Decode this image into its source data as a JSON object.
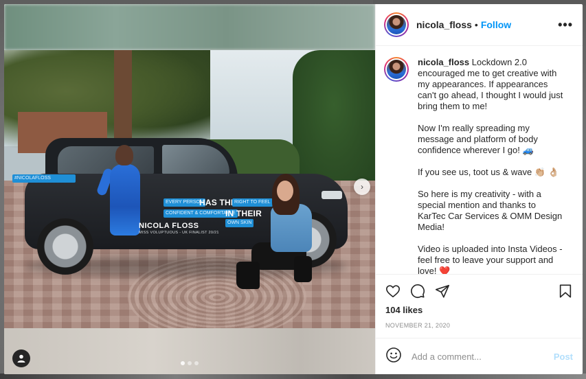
{
  "post": {
    "username": "nicola_floss",
    "separator": "•",
    "follow_label": "Follow",
    "more_label": "•••",
    "caption_paragraphs": [
      "Lockdown 2.0 encouraged me to get creative with my appearances. If appearances can't go ahead, I thought I would just bring them to me!",
      "Now I'm really spreading my message and platform of body confidence wherever I go! 🚙",
      "If you see us, toot us & wave 👏🏼 👌🏼",
      "So here is my creativity - with a special mention and thanks to KarTec Car Services & OMM Design Media!",
      "Video is uploaded into Insta Videos - feel free to leave your support and love! ❤️"
    ],
    "likes": "104 likes",
    "date": "NOVEMBER 21, 2020",
    "comment_placeholder": "Add a comment...",
    "post_label": "Post"
  },
  "media": {
    "car_wrap": {
      "banner": "#NICOLAFLOSS",
      "pill_every": "EVERY PERSON",
      "headline_1": "HAS THE",
      "pill_right": "RIGHT TO FEEL",
      "pill_confident": "CONFIDENT & COMFORTABLE",
      "headline_2": "IN THEIR",
      "pill_skin": "OWN SKIN",
      "name": "NICOLA FLOSS",
      "subtitle": "MISS VOLUPTUOUS - UK FINALIST 20/21"
    },
    "next_label": "›",
    "carousel": {
      "total": 3,
      "active": 1
    }
  },
  "icons": {
    "more": "more-options-icon",
    "like": "heart-icon",
    "comment": "comment-icon",
    "share": "share-icon",
    "save": "bookmark-icon",
    "emoji": "emoji-icon",
    "tag": "user-tag-icon",
    "next": "chevron-right-icon"
  },
  "colors": {
    "accent": "#0095f6",
    "post_disabled": "#b2dffc",
    "heart": "#e0245e"
  }
}
